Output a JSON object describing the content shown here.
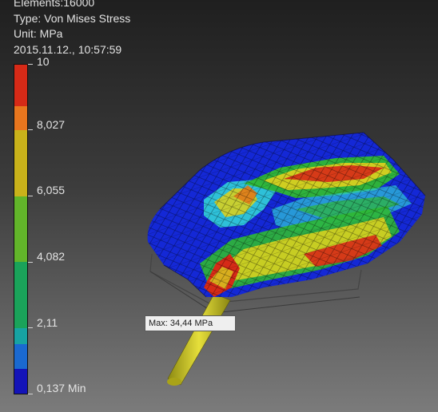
{
  "info": {
    "element_line": "Elements:16000",
    "type_line": "Type: Von Mises Stress",
    "unit_line": "Unit: MPa",
    "timestamp": "2015.11.12., 10:57:59"
  },
  "legend": {
    "max_label": "10",
    "labels": [
      "10",
      "8,027",
      "6,055",
      "4,082",
      "2,11",
      "0,137 Min"
    ],
    "colors": [
      "#d62a17",
      "#e8761e",
      "#c9b21a",
      "#62b52a",
      "#1aa35a",
      "#17a3a3",
      "#1a69d0",
      "#1313b8"
    ]
  },
  "probe": {
    "label": "Max: 34,44 MPa"
  },
  "colors": {
    "background_top": "#1f1f1f",
    "background_bottom": "#7b7b7b",
    "mesh_blue": "#1428d6",
    "stress_red": "#d62a17",
    "stress_yellow": "#d8d020",
    "stress_green": "#2fb834",
    "stress_cyan": "#2fc8d8",
    "pin_color": "#c9c11c"
  }
}
